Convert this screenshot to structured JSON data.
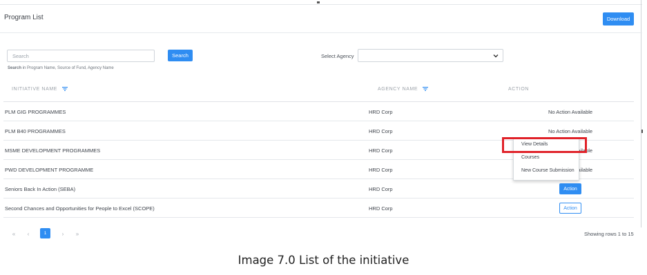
{
  "page": {
    "title": "Program List",
    "download_label": "Download"
  },
  "search": {
    "placeholder": "Search",
    "button_label": "Search",
    "hint_bold": "Search",
    "hint_rest": " in Program Name, Source of Fund, Agency Name"
  },
  "agency_filter": {
    "label": "Select Agency",
    "value": ""
  },
  "table": {
    "headers": {
      "name": "INITIATIVE NAME",
      "agency": "AGENCY NAME",
      "action": "ACTION"
    },
    "rows": [
      {
        "name": "PLM GIG PROGRAMMES",
        "agency": "HRD Corp",
        "action": "No Action Available"
      },
      {
        "name": "PLM B40 PROGRAMMES",
        "agency": "HRD Corp",
        "action": "No Action Available"
      },
      {
        "name": "MSME DEVELOPMENT PROGRAMMES",
        "agency": "HRD Corp",
        "action": "No Action Available"
      },
      {
        "name": "PWD DEVELOPMENT PROGRAMME",
        "agency": "HRD Corp",
        "action": "No Action Available"
      },
      {
        "name": "Seniors Back In Action (SEBA)",
        "agency": "HRD Corp",
        "action": "Action"
      },
      {
        "name": "Second Chances and Opportunities for People to Excel (SCOPE)",
        "agency": "HRD Corp",
        "action": "Action"
      }
    ]
  },
  "action_menu": {
    "items": [
      "View Details",
      "Courses",
      "New Course Submission"
    ],
    "highlighted": "View Details"
  },
  "pagination": {
    "first": "«",
    "prev": "‹",
    "current": "1",
    "next": "›",
    "last": "»",
    "summary": "Showing rows 1 to 15"
  },
  "caption": "Image 7.0 List of the initiative",
  "colors": {
    "accent": "#2f8df2",
    "highlight": "#e02128"
  }
}
